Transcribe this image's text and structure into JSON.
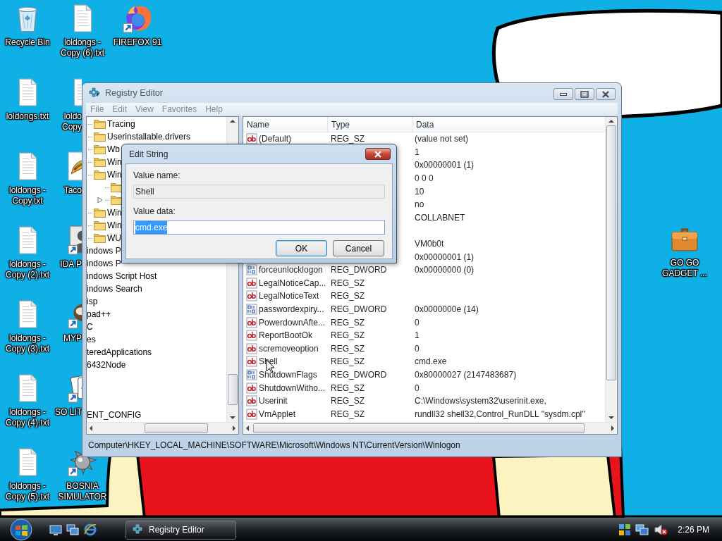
{
  "desktop": {
    "icons": [
      {
        "label": "Recycle Bin",
        "kind": "recycle-bin",
        "shortcut": false,
        "cut": false
      },
      {
        "label": "loldongs.txt",
        "kind": "text-file",
        "shortcut": false,
        "cut": false
      },
      {
        "label": "loldongs -\nCopy.txt",
        "kind": "text-file",
        "shortcut": false,
        "cut": false
      },
      {
        "label": "loldongs -\nCopy (2).txt",
        "kind": "text-file",
        "shortcut": false,
        "cut": false
      },
      {
        "label": "loldongs -\nCopy (3).txt",
        "kind": "text-file",
        "shortcut": false,
        "cut": false
      },
      {
        "label": "loldongs -\nCopy (4).txt",
        "kind": "text-file",
        "shortcut": false,
        "cut": false
      },
      {
        "label": "loldongs -\nCopy (5).txt",
        "kind": "text-file",
        "shortcut": false,
        "cut": false
      },
      {
        "label": "loldongs -\nCopy (6).txt",
        "kind": "text-file",
        "shortcut": false,
        "cut": false
      },
      {
        "label": "loldo\nCopy",
        "kind": "text-file",
        "shortcut": false,
        "cut": true
      },
      {
        "label": "Taco",
        "kind": "taco",
        "shortcut": false,
        "cut": true
      },
      {
        "label": "IDA P",
        "kind": "person",
        "shortcut": true,
        "cut": true
      },
      {
        "label": "MYP",
        "kind": "creature",
        "shortcut": true,
        "cut": true
      },
      {
        "label": "SO LIT",
        "kind": "cards",
        "shortcut": true,
        "cut": true
      },
      {
        "label": "BOSNIA\nSIMULATOR",
        "kind": "mine",
        "shortcut": true,
        "cut": false
      },
      {
        "label": "FIREFOX 91",
        "kind": "browser",
        "shortcut": true,
        "cut": false
      }
    ],
    "right_icons": [
      {
        "label": "GO GO\nGADGET ...",
        "kind": "briefcase",
        "shortcut": false,
        "cut": false
      }
    ]
  },
  "registry_editor": {
    "title": "Registry Editor",
    "active": false,
    "menu": [
      "File",
      "Edit",
      "View",
      "Favorites",
      "Help"
    ],
    "tree": {
      "items": [
        {
          "label": "Tracing"
        },
        {
          "label": "Userinstallable.drivers"
        },
        {
          "label": "Wb"
        },
        {
          "label": "Win"
        },
        {
          "label": "Win",
          "children": [
            {
              "expandable": false
            },
            {
              "expandable": true
            }
          ]
        },
        {
          "label": "Win"
        },
        {
          "label": "Win"
        },
        {
          "label": "WU"
        }
      ],
      "scrolled_items": [
        {
          "label": "indows P"
        },
        {
          "label": "indows P"
        },
        {
          "label": "indows Script Host"
        },
        {
          "label": "indows Search"
        },
        {
          "label": "isp"
        },
        {
          "label": "pad++"
        },
        {
          "label": "C"
        },
        {
          "label": "es"
        },
        {
          "label": "teredApplications"
        },
        {
          "label": "6432Node"
        },
        {
          "label": "ENT_CONFIG"
        }
      ]
    },
    "columns": [
      "Name",
      "Type",
      "Data"
    ],
    "rows": [
      {
        "kind": "string",
        "name": "(Default)",
        "type": "REG_SZ",
        "data": "(value not set)"
      },
      {
        "kind": "hidden",
        "data": "1"
      },
      {
        "kind": "hidden",
        "data": "0x00000001 (1)"
      },
      {
        "kind": "hidden",
        "data": "0 0 0"
      },
      {
        "kind": "hidden",
        "data": "10"
      },
      {
        "kind": "hidden",
        "data": "no"
      },
      {
        "kind": "hidden",
        "data": "COLLABNET"
      },
      {
        "kind": "hidden"
      },
      {
        "kind": "hidden",
        "data": "VM0b0t"
      },
      {
        "kind": "hidden",
        "data": "0x00000001 (1)"
      },
      {
        "kind": "dword",
        "name": "forceunlocklogon",
        "type": "REG_DWORD",
        "data": "0x00000000 (0)"
      },
      {
        "kind": "string",
        "name": "LegalNoticeCap...",
        "type": "REG_SZ"
      },
      {
        "kind": "string",
        "name": "LegalNoticeText",
        "type": "REG_SZ"
      },
      {
        "kind": "dword",
        "name": "passwordexpiry...",
        "type": "REG_DWORD",
        "data": "0x0000000e (14)"
      },
      {
        "kind": "string",
        "name": "PowerdownAfte...",
        "type": "REG_SZ",
        "data": "0"
      },
      {
        "kind": "string",
        "name": "ReportBootOk",
        "type": "REG_SZ",
        "data": "1"
      },
      {
        "kind": "string",
        "name": "scremoveoption",
        "type": "REG_SZ",
        "data": "0"
      },
      {
        "kind": "string",
        "name": "Shell",
        "type": "REG_SZ",
        "data": "cmd.exe"
      },
      {
        "kind": "dword",
        "name": "ShutdownFlags",
        "type": "REG_DWORD",
        "data": "0x80000027 (2147483687)"
      },
      {
        "kind": "string",
        "name": "ShutdownWitho...",
        "type": "REG_SZ",
        "data": "0"
      },
      {
        "kind": "string",
        "name": "Userinit",
        "type": "REG_SZ",
        "data": "C:\\Windows\\system32\\userinit.exe,"
      },
      {
        "kind": "string",
        "name": "VmApplet",
        "type": "REG_SZ",
        "data": "rundll32 shell32,Control_RunDLL \"sysdm.cpl\""
      }
    ],
    "status_bar": "Computer\\HKEY_LOCAL_MACHINE\\SOFTWARE\\Microsoft\\Windows NT\\CurrentVersion\\Winlogon"
  },
  "dialog": {
    "title": "Edit String",
    "value_name_label": "Value name:",
    "value_name": "Shell",
    "value_data_label": "Value data:",
    "value_data": "cmd.exe",
    "value_selected": true,
    "buttons": [
      {
        "label": "OK",
        "default": true
      },
      {
        "label": "Cancel",
        "default": false
      }
    ]
  },
  "taskbar": {
    "tasks": [
      {
        "label": "Registry Editor",
        "selected": false
      }
    ],
    "clock": "2:26 PM",
    "volume_muted": true
  }
}
